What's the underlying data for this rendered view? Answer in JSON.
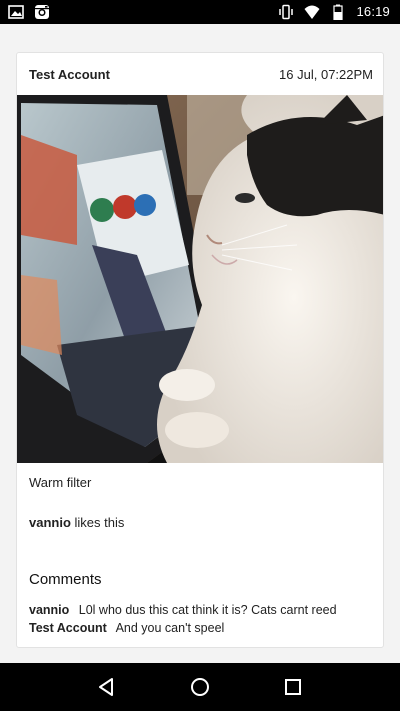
{
  "status_bar": {
    "time": "16:19",
    "left_icons": [
      "image-icon",
      "instagram-icon"
    ],
    "right_icons": [
      "vibrate-icon",
      "wifi-icon",
      "battery-icon"
    ]
  },
  "post": {
    "author": "Test Account",
    "timestamp": "16 Jul, 07:22PM",
    "caption": "Warm filter",
    "likes": {
      "user": "vannio",
      "text": "likes this"
    },
    "comments_title": "Comments",
    "comments": [
      {
        "user": "vannio",
        "text": "L0l who dus this cat think it is? Cats carnt reed"
      },
      {
        "user": "Test Account",
        "text": "And you can't speel"
      }
    ]
  },
  "nav_bar": {
    "icons": [
      "back-icon",
      "home-icon",
      "recents-icon"
    ]
  },
  "colors": {
    "status_bar": "#000000",
    "background": "#f3f3f3",
    "card": "#ffffff",
    "text": "#222222"
  }
}
